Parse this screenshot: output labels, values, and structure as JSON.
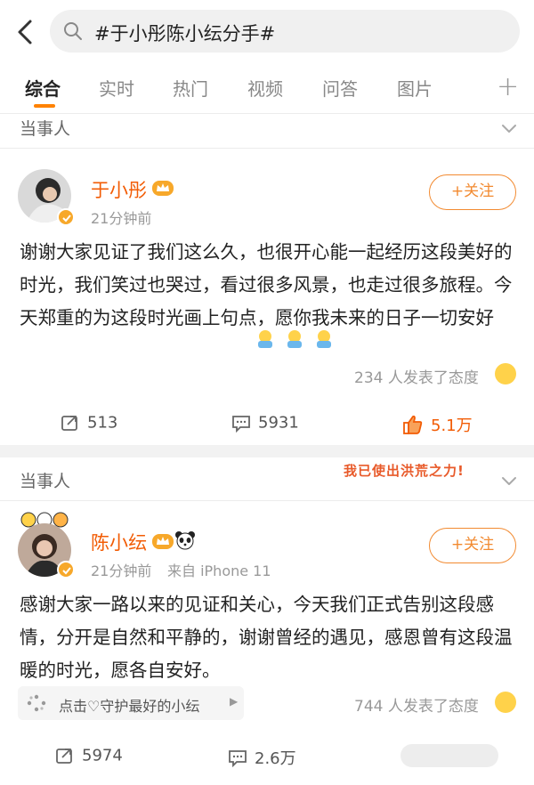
{
  "search": {
    "query": "#于小彤陈小纭分手#"
  },
  "tabs": [
    {
      "label": "综合"
    },
    {
      "label": "实时"
    },
    {
      "label": "热门"
    },
    {
      "label": "视频"
    },
    {
      "label": "问答"
    },
    {
      "label": "图片"
    }
  ],
  "tab_add": "+",
  "posts": [
    {
      "section_label": "当事人",
      "author": "于小彤",
      "time": "21分钟前",
      "source": "",
      "follow_label": "+关注",
      "text": "谢谢大家见证了我们这么久，也很开心能一起经历这段美好的时光，我们笑过也哭过，看过很多风景，也走过很多旅程。今天郑重的为这段时光画上句点，愿你我未来的日子一切安好",
      "reaction_text": "234 人发表了态度",
      "reposts": "513",
      "comments": "5931",
      "likes": "5.1万"
    },
    {
      "section_label": "当事人",
      "sticker": "我已使出洪荒之力!",
      "author": "陈小纭",
      "time": "21分钟前",
      "source": "来自 iPhone 11",
      "follow_label": "+关注",
      "text": "感谢大家一路以来的见证和关心，今天我们正式告别这段感情，分开是自然和平静的，谢谢曾经的遇见，感恩曾有这段温暖的时光，愿各自安好。",
      "pill_text": "点击♡守护最好的小纭",
      "reaction_text": "744 人发表了态度",
      "reposts": "5974",
      "comments": "2.6万"
    }
  ],
  "colors": {
    "accent": "#ff8200",
    "name": "#f25c05",
    "follow": "#f28a30"
  }
}
